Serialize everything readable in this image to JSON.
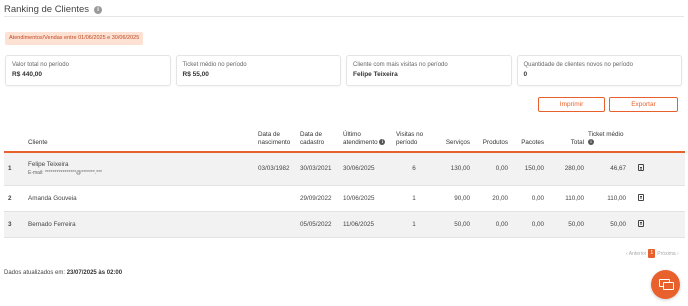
{
  "page": {
    "title": "Ranking de Clientes"
  },
  "period_badge": "Atendimentos/Vendas entre 01/06/2025 e 30/06/2025",
  "cards": [
    {
      "label": "Valor total no período",
      "value": "R$ 440,00"
    },
    {
      "label": "Ticket médio no período",
      "value": "R$ 55,00"
    },
    {
      "label": "Cliente com mais visitas no período",
      "value": "Felipe Teixeira"
    },
    {
      "label": "Quantidade de clientes novos no período",
      "value": "0"
    }
  ],
  "actions": {
    "print": "Imprimir",
    "export": "Exportar"
  },
  "table": {
    "headers": {
      "client": "Cliente",
      "birth": "Data de nascimento",
      "registered": "Data de cadastro",
      "last_visit": "Último atendimento",
      "visits": "Visitas no período",
      "services": "Serviços",
      "products": "Produtos",
      "packages": "Pacotes",
      "total": "Total",
      "ticket": "Ticket médio"
    },
    "rows": [
      {
        "rank": "1",
        "name": "Felipe Teixeira",
        "email": "E-mail: ****************@*******.***",
        "birth": "03/03/1982",
        "registered": "30/03/2021",
        "last_visit": "30/06/2025",
        "visits": "6",
        "services": "130,00",
        "products": "0,00",
        "packages": "150,00",
        "total": "280,00",
        "ticket": "46,67"
      },
      {
        "rank": "2",
        "name": "Amanda Gouveia",
        "email": "",
        "birth": "",
        "registered": "29/09/2022",
        "last_visit": "10/06/2025",
        "visits": "1",
        "services": "90,00",
        "products": "20,00",
        "packages": "0,00",
        "total": "110,00",
        "ticket": "110,00"
      },
      {
        "rank": "3",
        "name": "Bernado Ferreira",
        "email": "",
        "birth": "",
        "registered": "05/05/2022",
        "last_visit": "11/06/2025",
        "visits": "1",
        "services": "50,00",
        "products": "0,00",
        "packages": "0,00",
        "total": "50,00",
        "ticket": "50,00"
      }
    ]
  },
  "pagination": {
    "prev": "‹ Anterior",
    "current": "1",
    "next": "Próxima ›"
  },
  "footer": {
    "label": "Dados atualizados em:",
    "value": "23/07/2025 às 02:00"
  },
  "colors": {
    "accent": "#e8612c",
    "badge_bg": "#fde2d4"
  }
}
